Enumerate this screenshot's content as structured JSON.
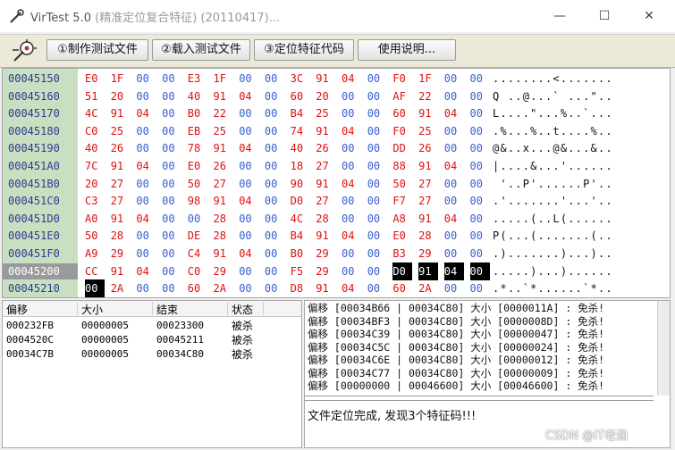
{
  "window": {
    "title": "VirTest 5.0",
    "title_subtitle": "(精准定位复合特征) (20110417)...",
    "minimize_glyph": "—",
    "maximize_glyph": "☐",
    "close_glyph": "✕"
  },
  "toolbar": {
    "logo_icon": "pin-target-icon",
    "buttons": [
      {
        "label": "①制作测试文件"
      },
      {
        "label": "②载入测试文件"
      },
      {
        "label": "③定位特征代码"
      },
      {
        "label": "使用说明..."
      }
    ]
  },
  "hex_view": {
    "rows": [
      {
        "address": "00045150",
        "bytes": [
          "E0",
          "1F",
          "00",
          "00",
          "E3",
          "1F",
          "00",
          "00",
          "3C",
          "91",
          "04",
          "00",
          "F0",
          "1F",
          "00",
          "00"
        ],
        "ascii": "........<......."
      },
      {
        "address": "00045160",
        "bytes": [
          "51",
          "20",
          "00",
          "00",
          "40",
          "91",
          "04",
          "00",
          "60",
          "20",
          "00",
          "00",
          "AF",
          "22",
          "00",
          "00"
        ],
        "ascii": "Q ..@...` ...\".."
      },
      {
        "address": "00045170",
        "bytes": [
          "4C",
          "91",
          "04",
          "00",
          "B0",
          "22",
          "00",
          "00",
          "B4",
          "25",
          "00",
          "00",
          "60",
          "91",
          "04",
          "00"
        ],
        "ascii": "L....\"...%..`..."
      },
      {
        "address": "00045180",
        "bytes": [
          "C0",
          "25",
          "00",
          "00",
          "EB",
          "25",
          "00",
          "00",
          "74",
          "91",
          "04",
          "00",
          "F0",
          "25",
          "00",
          "00"
        ],
        "ascii": ".%...%..t....%.."
      },
      {
        "address": "00045190",
        "bytes": [
          "40",
          "26",
          "00",
          "00",
          "78",
          "91",
          "04",
          "00",
          "40",
          "26",
          "00",
          "00",
          "DD",
          "26",
          "00",
          "00"
        ],
        "ascii": "@&..x...@&...&.."
      },
      {
        "address": "000451A0",
        "bytes": [
          "7C",
          "91",
          "04",
          "00",
          "E0",
          "26",
          "00",
          "00",
          "18",
          "27",
          "00",
          "00",
          "88",
          "91",
          "04",
          "00"
        ],
        "ascii": "|....&...'......"
      },
      {
        "address": "000451B0",
        "bytes": [
          "20",
          "27",
          "00",
          "00",
          "50",
          "27",
          "00",
          "00",
          "90",
          "91",
          "04",
          "00",
          "50",
          "27",
          "00",
          "00"
        ],
        "ascii": " '..P'......P'.."
      },
      {
        "address": "000451C0",
        "bytes": [
          "C3",
          "27",
          "00",
          "00",
          "98",
          "91",
          "04",
          "00",
          "D0",
          "27",
          "00",
          "00",
          "F7",
          "27",
          "00",
          "00"
        ],
        "ascii": ".'.......'...'.."
      },
      {
        "address": "000451D0",
        "bytes": [
          "A0",
          "91",
          "04",
          "00",
          "00",
          "28",
          "00",
          "00",
          "4C",
          "28",
          "00",
          "00",
          "A8",
          "91",
          "04",
          "00"
        ],
        "ascii": ".....(..L(......"
      },
      {
        "address": "000451E0",
        "bytes": [
          "50",
          "28",
          "00",
          "00",
          "DE",
          "28",
          "00",
          "00",
          "B4",
          "91",
          "04",
          "00",
          "E0",
          "28",
          "00",
          "00"
        ],
        "ascii": "P(...(.......(.."
      },
      {
        "address": "000451F0",
        "bytes": [
          "A9",
          "29",
          "00",
          "00",
          "C4",
          "91",
          "04",
          "00",
          "B0",
          "29",
          "00",
          "00",
          "B3",
          "29",
          "00",
          "00"
        ],
        "ascii": ".).......)...).."
      },
      {
        "address": "00045200",
        "bytes": [
          "CC",
          "91",
          "04",
          "00",
          "C0",
          "29",
          "00",
          "00",
          "F5",
          "29",
          "00",
          "00",
          "D0",
          "91",
          "04",
          "00"
        ],
        "ascii": ".....)...)......"
      },
      {
        "address": "00045210",
        "bytes": [
          "00",
          "2A",
          "00",
          "00",
          "60",
          "2A",
          "00",
          "00",
          "D8",
          "91",
          "04",
          "00",
          "60",
          "2A",
          "00",
          "00"
        ],
        "ascii": ".*..`*......`*.."
      }
    ],
    "selected_row_index": 11,
    "highlight_bytes_row11": [
      12,
      13,
      14,
      15
    ],
    "highlight_bytes_row12": [
      0
    ]
  },
  "results_list": {
    "columns": [
      "偏移",
      "大小",
      "结束",
      "状态"
    ],
    "rows": [
      {
        "offset": "000232FB",
        "size": "00000005",
        "end": "00023300",
        "status": "被杀"
      },
      {
        "offset": "0004520C",
        "size": "00000005",
        "end": "00045211",
        "status": "被杀"
      },
      {
        "offset": "00034C7B",
        "size": "00000005",
        "end": "00034C80",
        "status": "被杀"
      }
    ]
  },
  "log": {
    "lines": [
      "偏移 [00034B66 | 00034C80] 大小 [0000011A] : 免杀!",
      "偏移 [00034BF3 | 00034C80] 大小 [0000008D] : 免杀!",
      "偏移 [00034C39 | 00034C80] 大小 [00000047] : 免杀!",
      "偏移 [00034C5C | 00034C80] 大小 [00000024] : 免杀!",
      "偏移 [00034C6E | 00034C80] 大小 [00000012] : 免杀!",
      "偏移 [00034C77 | 00034C80] 大小 [00000009] : 免杀!",
      "偏移 [00000000 | 00046600] 大小 [00046600] : 免杀!"
    ],
    "status_message": "文件定位完成, 发现3个特征码!!!"
  },
  "watermark": "CSDN @IT老涵",
  "colors": {
    "address_column_bg": "#c9dfc1",
    "byte_nonzero": "#e01010",
    "byte_zero": "#3a5fcd",
    "address_text": "#2a3d8f"
  }
}
